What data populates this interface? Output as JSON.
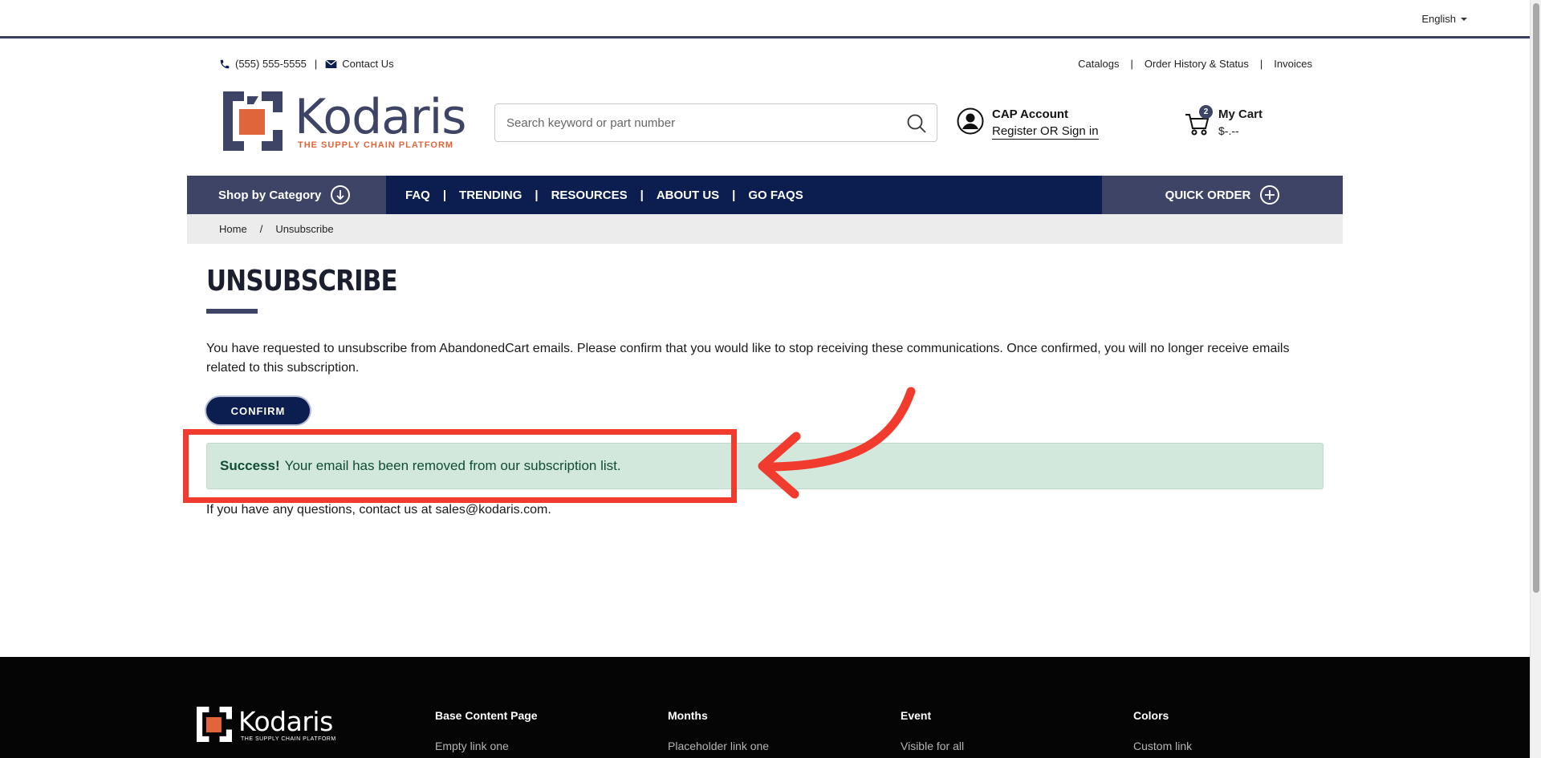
{
  "topbar": {
    "language": "English"
  },
  "contact": {
    "phone": "(555) 555-5555",
    "separator": "|",
    "contact_label": "Contact Us"
  },
  "util_links": [
    "Catalogs",
    "Order History & Status",
    "Invoices"
  ],
  "logo": {
    "name": "Kodaris",
    "tagline": "THE SUPPLY CHAIN PLATFORM"
  },
  "search": {
    "placeholder": "Search keyword or part number",
    "value": ""
  },
  "account": {
    "title": "CAP Account",
    "link": "Register OR Sign in"
  },
  "cart": {
    "title": "My Cart",
    "total": "$-.--",
    "count": "2"
  },
  "nav": {
    "shop_label": "Shop by Category",
    "links": [
      "FAQ",
      "TRENDING",
      "RESOURCES",
      "ABOUT US",
      "GO FAQS"
    ],
    "quick_order": "QUICK ORDER"
  },
  "breadcrumb": {
    "home": "Home",
    "sep": "/",
    "current": "Unsubscribe"
  },
  "main": {
    "title": "UNSUBSCRIBE",
    "description": "You have requested to unsubscribe from AbandonedCart emails. Please confirm that you would like to stop receiving these communications. Once confirmed, you will no longer receive emails related to this subscription.",
    "confirm_label": "CONFIRM",
    "alert_strong": "Success!",
    "alert_text": "Your email has been removed from our subscription list.",
    "questions": "If you have any questions, contact us at sales@kodaris.com."
  },
  "footer": {
    "logo_name": "Kodaris",
    "logo_tagline": "THE SUPPLY CHAIN PLATFORM",
    "columns": [
      {
        "heading": "Base Content Page",
        "link": "Empty link one"
      },
      {
        "heading": "Months",
        "link": "Placeholder link one"
      },
      {
        "heading": "Event",
        "link": "Visible for all"
      },
      {
        "heading": "Colors",
        "link": "Custom link"
      }
    ]
  },
  "colors": {
    "navy": "#0c1e4f",
    "slate": "#3d4466",
    "brand_orange": "#e0653a",
    "success_bg": "#d3e8dc",
    "annotation_red": "#f23b2f"
  },
  "icons": [
    "phone-icon",
    "mail-icon",
    "search-icon",
    "user-icon",
    "cart-icon",
    "arrow-down-circle-icon",
    "plus-circle-icon",
    "caret-down-icon"
  ]
}
